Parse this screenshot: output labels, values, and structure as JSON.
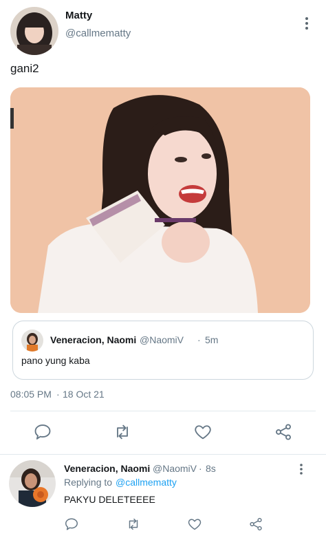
{
  "tweet": {
    "author_name": "Matty",
    "author_handle": "@callmematty",
    "text": "gani2",
    "time": "08:05 PM",
    "separator": "·",
    "date": "18 Oct 21",
    "more_icon": "more-vertical-icon"
  },
  "quote": {
    "author_name": "Veneracion, Naomi",
    "author_handle": "@NaomiV",
    "separator": "·",
    "time": "5m",
    "text": "pano yung kaba"
  },
  "actions": {
    "reply_icon": "reply-icon",
    "retweet_icon": "retweet-icon",
    "like_icon": "heart-icon",
    "share_icon": "share-icon"
  },
  "reply": {
    "author_name": "Veneracion, Naomi",
    "author_handle": "@NaomiV",
    "separator": "·",
    "time": "8s",
    "replying_label": "Replying to",
    "replying_handle": "@callmematty",
    "text": "PAKYU DELETEEEE"
  },
  "colors": {
    "text": "#14171a",
    "secondary": "#657786",
    "link": "#1da1f2",
    "border": "#ccd6dd",
    "icon": "#657786"
  }
}
